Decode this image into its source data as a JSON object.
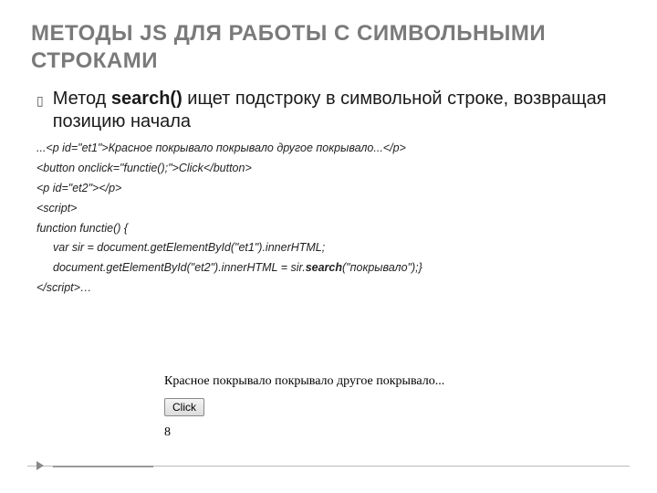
{
  "title": "МЕТОДЫ JS ДЛЯ РАБОТЫ С СИМВОЛЬНЫМИ СТРОКАМИ",
  "bullet": {
    "pre": "Метод ",
    "method": "search()",
    "post": " ищет подстроку в символьной строке, возвращая позицию начала"
  },
  "code": {
    "l1": "...<p id=\"et1\">Красное покрывало покрывало другое покрывало...</p>",
    "l2": "<button onclick=\"functie();\">Click</button>",
    "l3": "<p id=\"et2\"></p>",
    "l4": "<script>",
    "l5": "function functie() {",
    "l6": "var sir = document.getElementById(\"et1\").innerHTML;",
    "l7a": "document.getElementById(\"et2\").innerHTML = sir.",
    "l7method": "search",
    "l7b": "(\"покрывало\");}",
    "l8": "</script>…"
  },
  "demo": {
    "text": "Красное покрывало покрывало другое покрывало...",
    "button": "Click",
    "result": "8"
  }
}
